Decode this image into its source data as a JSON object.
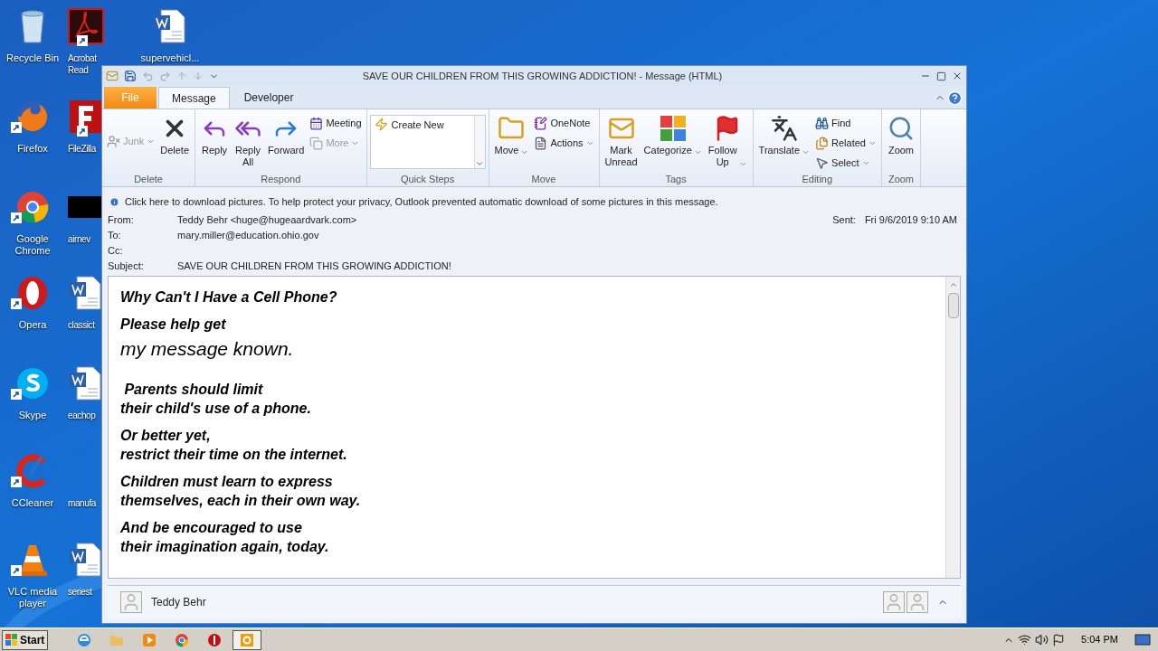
{
  "desktop_icons": [
    {
      "label": "Recycle Bin",
      "kind": "recycle"
    },
    {
      "label": "Firefox",
      "kind": "firefox"
    },
    {
      "label": "Google Chrome",
      "kind": "chrome"
    },
    {
      "label": "Opera",
      "kind": "opera"
    },
    {
      "label": "Skype",
      "kind": "skype"
    },
    {
      "label": "CCleaner",
      "kind": "ccleaner"
    },
    {
      "label": "VLC media player",
      "kind": "vlc"
    },
    {
      "label": "Acrobat Read",
      "kind": "acrobat"
    },
    {
      "label": "FileZilla",
      "kind": "filezilla"
    },
    {
      "label": "airnev",
      "kind": "blank"
    },
    {
      "label": "classict",
      "kind": "word"
    },
    {
      "label": "eachop",
      "kind": "word"
    },
    {
      "label": "manufa",
      "kind": "none"
    },
    {
      "label": "seriest",
      "kind": "word"
    },
    {
      "label": "supervehicl...",
      "kind": "word"
    }
  ],
  "window": {
    "title": "SAVE OUR CHILDREN FROM THIS GROWING ADDICTION! - Message (HTML)"
  },
  "tabs": [
    {
      "label": "File",
      "kind": "file",
      "selected": false
    },
    {
      "label": "Message",
      "kind": "tab",
      "selected": true
    },
    {
      "label": "Developer",
      "kind": "tab",
      "selected": false
    }
  ],
  "ribbon": [
    {
      "label": "Delete",
      "items": [
        {
          "label": "Junk",
          "kind": "small",
          "disabled": true,
          "dropdown": true
        },
        {
          "label": "Delete",
          "kind": "large",
          "disabled": false,
          "dropdown": false
        }
      ]
    },
    {
      "label": "Respond",
      "items": [
        {
          "label": "Reply",
          "kind": "large",
          "disabled": false,
          "dropdown": false
        },
        {
          "label": "Reply All",
          "kind": "large",
          "disabled": false,
          "dropdown": false
        },
        {
          "label": "Forward",
          "kind": "large",
          "disabled": false,
          "dropdown": false
        },
        {
          "label": "Meeting",
          "kind": "small",
          "disabled": false,
          "dropdown": false
        },
        {
          "label": "More",
          "kind": "small",
          "disabled": true,
          "dropdown": true
        }
      ]
    },
    {
      "label": "Quick Steps",
      "items": [
        {
          "label": "Create New",
          "kind": "gallery"
        }
      ]
    },
    {
      "label": "Move",
      "items": [
        {
          "label": "Move",
          "kind": "large",
          "disabled": false,
          "dropdown": true
        },
        {
          "label": "OneNote",
          "kind": "small",
          "disabled": false,
          "dropdown": false
        },
        {
          "label": "Actions",
          "kind": "small",
          "disabled": false,
          "dropdown": true
        }
      ]
    },
    {
      "label": "Tags",
      "items": [
        {
          "label": "Mark Unread",
          "kind": "large",
          "disabled": false,
          "dropdown": false
        },
        {
          "label": "Categorize",
          "kind": "large",
          "disabled": false,
          "dropdown": true
        },
        {
          "label": "Follow Up",
          "kind": "large",
          "disabled": false,
          "dropdown": true
        }
      ]
    },
    {
      "label": "Editing",
      "items": [
        {
          "label": "Translate",
          "kind": "large",
          "disabled": false,
          "dropdown": true
        },
        {
          "label": "Find",
          "kind": "small",
          "disabled": false,
          "dropdown": false
        },
        {
          "label": "Related",
          "kind": "small",
          "disabled": false,
          "dropdown": true
        },
        {
          "label": "Select",
          "kind": "small",
          "disabled": false,
          "dropdown": true
        }
      ]
    },
    {
      "label": "Zoom",
      "items": [
        {
          "label": "Zoom",
          "kind": "large",
          "disabled": false,
          "dropdown": false
        }
      ]
    }
  ],
  "infobar": "Click here to download pictures. To help protect your privacy, Outlook prevented automatic download of some pictures in this message.",
  "header": {
    "fields": [
      {
        "label": "From:",
        "value": "Teddy Behr <huge@hugeaardvark.com>"
      },
      {
        "label": "To:",
        "value": "mary.miller@education.ohio.gov"
      },
      {
        "label": "Cc:"
      },
      {
        "label": "Subject:",
        "value": "SAVE OUR CHILDREN FROM THIS GROWING ADDICTION!"
      }
    ],
    "sent_label": "Sent:",
    "sent_value": "Fri 9/6/2019 9:10 AM"
  },
  "body": [
    {
      "kind": "bold",
      "lines": [
        "Why Can't I Have a Cell Phone?"
      ]
    },
    {
      "kind": "bold",
      "lines": [
        "Please help get"
      ]
    },
    {
      "kind": "large",
      "lines": [
        "my message known."
      ]
    },
    {
      "kind": "bold",
      "lines": [
        " Parents should limit",
        "their child's use of a phone."
      ]
    },
    {
      "kind": "bold",
      "lines": [
        "Or better yet,",
        "restrict their time on the internet."
      ]
    },
    {
      "kind": "bold",
      "lines": [
        "Children must learn to express",
        "themselves, each in their own way."
      ]
    },
    {
      "kind": "bold",
      "lines": [
        "And be encouraged to use",
        "their imagination again, today."
      ]
    }
  ],
  "people_pane": {
    "name": "Teddy Behr"
  },
  "taskbar": {
    "start": "Start",
    "apps": [
      {
        "kind": "ie",
        "selected": false
      },
      {
        "kind": "explorer",
        "selected": false
      },
      {
        "kind": "media",
        "selected": false
      },
      {
        "kind": "chrome",
        "selected": false
      },
      {
        "kind": "stop",
        "selected": false
      },
      {
        "kind": "outlook",
        "selected": true
      }
    ],
    "time": "5:04 PM"
  }
}
